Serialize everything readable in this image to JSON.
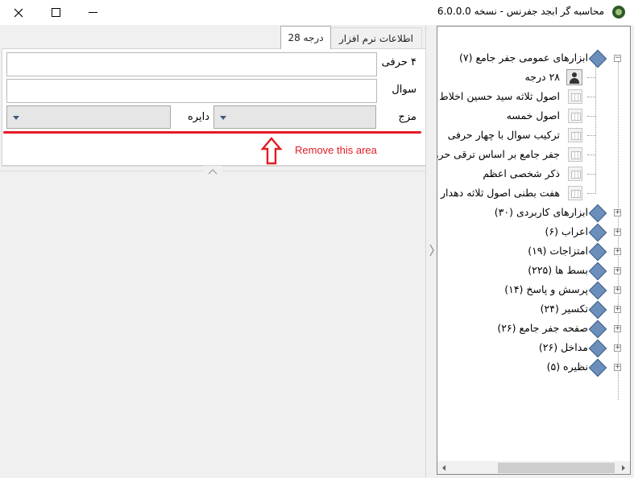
{
  "window": {
    "title": "محاسبه گر ابجد جفرنس - نسخه 6.0.0.0"
  },
  "tabs": [
    {
      "label": "درجه 28",
      "active": true
    },
    {
      "label": "اطلاعات نرم افزار",
      "active": false
    }
  ],
  "form": {
    "field1_label": "۴ حرفی",
    "field1_value": "",
    "field2_label": "سوال",
    "field2_value": "",
    "mazj_label": "مزج",
    "mazj_value": "",
    "dayere_label": "دایره",
    "dayere_value": ""
  },
  "annotation": {
    "text": "Remove this area",
    "color": "#e21b25"
  },
  "tree": {
    "root": {
      "label": "ابزارهای عمومی جفر جامع (۷)",
      "expanded": true
    },
    "children": [
      {
        "label": "۲۸ درجه",
        "icon": "user-icon"
      },
      {
        "label": "اصول ثلاثه سید حسین اخلاط",
        "icon": "grid-icon"
      },
      {
        "label": "اصول خمسه",
        "icon": "grid-icon"
      },
      {
        "label": "ترکیب سوال با چهار حرفی",
        "icon": "grid-icon"
      },
      {
        "label": "جفر جامع بر اساس ترقی حرو",
        "icon": "grid-icon"
      },
      {
        "label": "ذکر شخصی اعظم",
        "icon": "grid-icon"
      },
      {
        "label": "هفت بطنی اصول ثلاثه دهدار",
        "icon": "grid-icon"
      }
    ],
    "groups": [
      {
        "label": "ابزارهای کاربردی (۳۰)"
      },
      {
        "label": "اعراب (۶)"
      },
      {
        "label": "امتزاجات (۱۹)"
      },
      {
        "label": "بسط ها (۲۲۵)"
      },
      {
        "label": "پرسش و پاسخ (۱۴)"
      },
      {
        "label": "تکسیر (۲۴)"
      },
      {
        "label": "صفحه جفر جامع (۲۶)"
      },
      {
        "label": "مداخل (۲۶)"
      },
      {
        "label": "نظیره (۵)"
      }
    ]
  }
}
